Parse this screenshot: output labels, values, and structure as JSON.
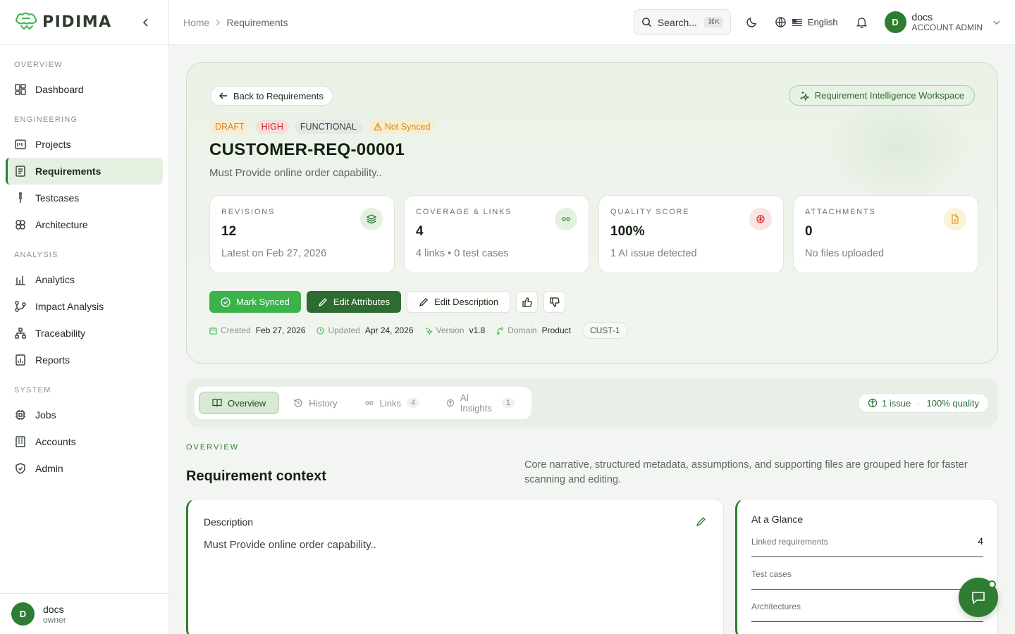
{
  "brand": {
    "name": "PIDIMA"
  },
  "sidebar": {
    "sections": [
      {
        "label": "OVERVIEW",
        "items": [
          {
            "label": "Dashboard",
            "icon": "dashboard-icon"
          }
        ]
      },
      {
        "label": "ENGINEERING",
        "items": [
          {
            "label": "Projects",
            "icon": "projects-icon"
          },
          {
            "label": "Requirements",
            "icon": "requirements-icon",
            "active": true
          },
          {
            "label": "Testcases",
            "icon": "testcases-icon"
          },
          {
            "label": "Architecture",
            "icon": "architecture-icon"
          }
        ]
      },
      {
        "label": "ANALYSIS",
        "items": [
          {
            "label": "Analytics",
            "icon": "analytics-icon"
          },
          {
            "label": "Impact Analysis",
            "icon": "impact-icon"
          },
          {
            "label": "Traceability",
            "icon": "traceability-icon"
          },
          {
            "label": "Reports",
            "icon": "reports-icon"
          }
        ]
      },
      {
        "label": "SYSTEM",
        "items": [
          {
            "label": "Jobs",
            "icon": "jobs-icon"
          },
          {
            "label": "Accounts",
            "icon": "accounts-icon"
          },
          {
            "label": "Admin",
            "icon": "admin-icon"
          }
        ]
      }
    ],
    "user": {
      "initial": "D",
      "name": "docs",
      "role": "owner"
    }
  },
  "header": {
    "breadcrumb": [
      "Home",
      "Requirements"
    ],
    "search_label": "Search...",
    "search_shortcut": "⌘K",
    "language": "English",
    "user": {
      "initial": "D",
      "name": "docs",
      "role": "ACCOUNT ADMIN"
    }
  },
  "hero": {
    "back_label": "Back to Requirements",
    "workspace_label": "Requirement Intelligence Workspace",
    "badges": {
      "status": "DRAFT",
      "priority": "HIGH",
      "type": "FUNCTIONAL",
      "sync": "Not Synced"
    },
    "title": "CUSTOMER-REQ-00001",
    "subtitle": "Must Provide online order capability..",
    "stats": [
      {
        "label": "REVISIONS",
        "value": "12",
        "meta": "Latest on Feb 27, 2026",
        "icon": "layers-icon",
        "color": "#2e7d32",
        "bg": "#e4f1e1"
      },
      {
        "label": "COVERAGE & LINKS",
        "value": "4",
        "meta": "4 links • 0 test cases",
        "icon": "link-icon",
        "color": "#2e7d32",
        "bg": "#e4f1e1"
      },
      {
        "label": "QUALITY SCORE",
        "value": "100%",
        "meta": "1 AI issue detected",
        "icon": "brain-icon",
        "color": "#d32f2f",
        "bg": "#fbe3e3"
      },
      {
        "label": "ATTACHMENTS",
        "value": "0",
        "meta": "No files uploaded",
        "icon": "file-icon",
        "color": "#e0a021",
        "bg": "#fcf1d9"
      }
    ],
    "actions": {
      "mark_synced": "Mark Synced",
      "edit_attributes": "Edit Attributes",
      "edit_description": "Edit Description"
    },
    "meta": {
      "created_label": "Created",
      "created_value": "Feb 27, 2026",
      "updated_label": "Updated",
      "updated_value": "Apr 24, 2026",
      "version_label": "Version",
      "version_value": "v1.8",
      "domain_label": "Domain",
      "domain_value": "Product",
      "tag": "CUST-1"
    }
  },
  "tabs": {
    "items": [
      {
        "label": "Overview",
        "active": true
      },
      {
        "label": "History"
      },
      {
        "label": "Links",
        "count": "4"
      },
      {
        "label": "AI Insights",
        "count": "1"
      }
    ],
    "issues": "1 issue",
    "quality": "100% quality"
  },
  "overview": {
    "eyebrow": "OVERVIEW",
    "title": "Requirement context",
    "description": "Core narrative, structured metadata, assumptions, and supporting files are grouped here for faster scanning and editing.",
    "desc_card_title": "Description",
    "desc_card_text": "Must Provide online order capability..",
    "glance_title": "At a Glance",
    "glance_rows": [
      {
        "label": "Linked requirements",
        "value": "4"
      },
      {
        "label": "Test cases",
        "value": ""
      },
      {
        "label": "Architectures",
        "value": ""
      }
    ]
  }
}
